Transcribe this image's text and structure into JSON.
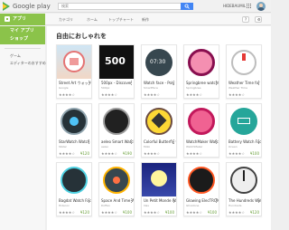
{
  "topbar": {
    "logo": "Google play",
    "search_placeholder": "検索",
    "user": "HIDEBAUMIL"
  },
  "nav": {
    "section": "アプリ",
    "items": [
      "カテゴリ",
      "ホーム",
      "トップチャート",
      "新作"
    ],
    "help": "?",
    "settings": "⚙"
  },
  "sidebar": {
    "items": [
      "マイ アプリ",
      "ショップ"
    ],
    "sub_items": [
      "ゲーム",
      "エディターのおすすめ"
    ]
  },
  "main": {
    "title": "自由におしゃれを"
  },
  "cards": [
    {
      "title": "Street Art ウォッチ",
      "dev": "Google",
      "price": "",
      "icon": "street-art-thumbnail",
      "stars": "★★★★☆"
    },
    {
      "title": "500px - Discover",
      "dev": "500px",
      "price": "",
      "icon": "500px-logo-thumbnail",
      "stars": "★★★★☆"
    },
    {
      "title": "Watch face - Poly",
      "dev": "SmartFace",
      "price": "",
      "icon": "digital-watch-thumbnail",
      "stars": "★★★★☆"
    },
    {
      "title": "Springbree watchfa",
      "dev": "Springbree",
      "price": "",
      "icon": "pink-watch-thumbnail",
      "stars": "★★★★☆"
    },
    {
      "title": "Weather Time for And",
      "dev": "Weather Time",
      "price": "",
      "icon": "weather-watch-thumbnail",
      "stars": "★★★★☆"
    },
    {
      "title": "StarWatch Watch Fa",
      "dev": "Ststar",
      "price": "¥120",
      "icon": "dark-watch-thumbnail",
      "stars": "★★★★☆"
    },
    {
      "title": "aeleo Smart Watch",
      "dev": "aeleo",
      "price": "¥190",
      "icon": "smart-watch-thumbnail",
      "stars": "★★★★☆"
    },
    {
      "title": "Colorful Butterfly w",
      "dev": "Mobi",
      "price": "",
      "icon": "butterfly-watch-thumbnail",
      "stars": "★★★★☆"
    },
    {
      "title": "WatchMaker Watch",
      "dev": "WatchMaker",
      "price": "",
      "icon": "watchmaker-thumbnail",
      "stars": "★★★★☆"
    },
    {
      "title": "Battery Watch Face",
      "dev": "Ocean",
      "price": "¥100",
      "icon": "battery-watch-thumbnail",
      "stars": "★★★★☆"
    },
    {
      "title": "Bagdat Watch Face",
      "dev": "Hidenor",
      "price": "¥120",
      "icon": "bagdat-watch-thumbnail",
      "stars": "★★★★☆"
    },
    {
      "title": "Space And Time Wat",
      "dev": "Doffen",
      "price": "¥100",
      "icon": "space-watch-thumbnail",
      "stars": "★★★★☆"
    },
    {
      "title": "Un Petit Monde Wa",
      "dev": "Ilias",
      "price": "¥100",
      "icon": "night-watch-thumbnail",
      "stars": "★★★★☆"
    },
    {
      "title": "Glowing ElecTRON",
      "dev": "Ghostone",
      "price": "¥100",
      "icon": "glow-watch-thumbnail",
      "stars": "★★★★☆"
    },
    {
      "title": "The Hundreds Watch",
      "dev": "Hundreds",
      "price": "¥120",
      "icon": "hundreds-watch-thumbnail",
      "stars": "★★★★☆"
    }
  ],
  "colors": {
    "accent": "#8bc34a",
    "search_button": "#4285f4",
    "price": "#689f38"
  }
}
